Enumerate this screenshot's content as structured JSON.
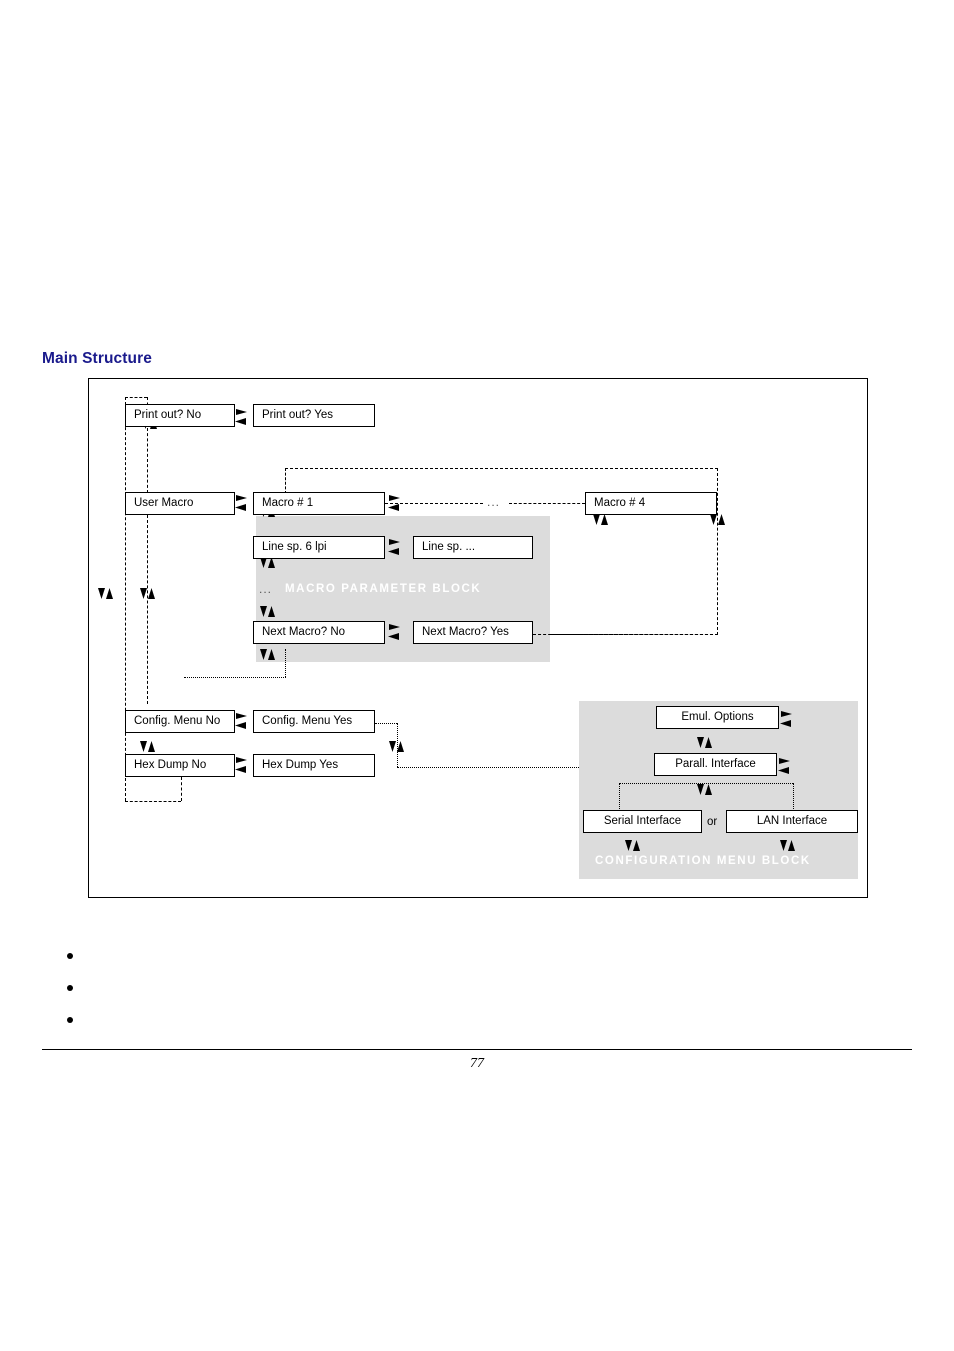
{
  "page": {
    "title": "Main Structure",
    "title_color": "#1a1a8c",
    "number": "77"
  },
  "diagram": {
    "blocks": [
      {
        "caption": "MACRO PARAMETER BLOCK"
      },
      {
        "caption": "CONFIGURATION MENU BLOCK"
      }
    ],
    "boxes": {
      "print_out_no": "Print out? No",
      "print_out_yes": "Print out? Yes",
      "user_macro": "User Macro",
      "macro_1": "Macro # 1",
      "macro_4": "Macro # 4",
      "line_sp_6lpi": "Line sp. 6 lpi",
      "line_sp_etc": "Line sp. ...",
      "next_macro_no": "Next Macro? No",
      "next_macro_yes": "Next Macro? Yes",
      "config_menu_no": "Config. Menu No",
      "config_menu_yes": "Config. Menu  Yes",
      "hex_dump_no": "Hex Dump No",
      "hex_dump_yes": "Hex Dump  Yes",
      "emul_options": "Emul. Options",
      "parall_interface": "Parall. Interface",
      "serial_interface": "Serial Interface",
      "lan_interface": "LAN Interface"
    },
    "labels": {
      "or": "or",
      "ellipsis_macro_chain": "...",
      "ellipsis_macro_params": "...",
      "ellipsis_macro_block_left": "..."
    },
    "icons": {
      "horizontal_toggle": "left-right-arrow-icon",
      "vertical_toggle": "up-down-arrow-icon"
    },
    "colors": {
      "shade": "#dcdcdc",
      "caption_text": "#ffffff",
      "line": "#000000"
    }
  },
  "bullets": [
    {
      "text": ""
    },
    {
      "text": ""
    },
    {
      "text": ""
    }
  ]
}
